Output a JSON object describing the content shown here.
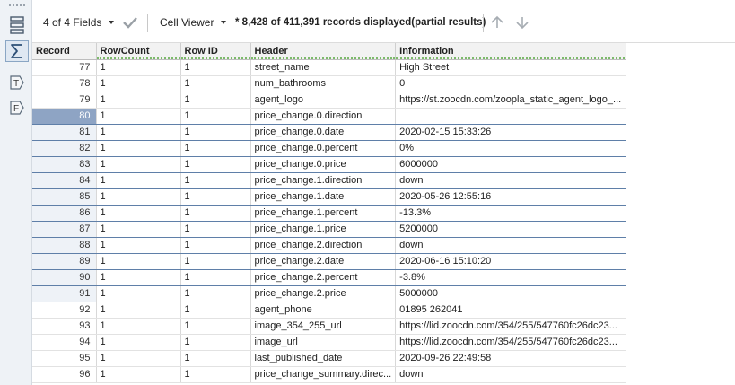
{
  "toolbar": {
    "fields_label": "4 of 4 Fields",
    "viewer_label": "Cell Viewer",
    "status_text": "* 8,428 of 411,391 records displayed(partial results)"
  },
  "rail": {
    "icons": [
      "table-view-icon",
      "summarize-icon",
      "text-type-icon",
      "formula-type-icon"
    ]
  },
  "grid": {
    "columns": [
      "Record",
      "RowCount",
      "Row ID",
      "Header",
      "Information"
    ],
    "active_record": "80",
    "rows": [
      {
        "record": "77",
        "rowcount": "1",
        "rowid": "1",
        "header": "street_name",
        "info": "High Street",
        "selected": false
      },
      {
        "record": "78",
        "rowcount": "1",
        "rowid": "1",
        "header": "num_bathrooms",
        "info": "0",
        "selected": false
      },
      {
        "record": "79",
        "rowcount": "1",
        "rowid": "1",
        "header": "agent_logo",
        "info": "https://st.zoocdn.com/zoopla_static_agent_logo_...",
        "selected": false
      },
      {
        "record": "80",
        "rowcount": "1",
        "rowid": "1",
        "header": "price_change.0.direction",
        "info": "",
        "selected": true
      },
      {
        "record": "81",
        "rowcount": "1",
        "rowid": "1",
        "header": "price_change.0.date",
        "info": "2020-02-15 15:33:26",
        "selected": true
      },
      {
        "record": "82",
        "rowcount": "1",
        "rowid": "1",
        "header": "price_change.0.percent",
        "info": "0%",
        "selected": true
      },
      {
        "record": "83",
        "rowcount": "1",
        "rowid": "1",
        "header": "price_change.0.price",
        "info": "6000000",
        "selected": true
      },
      {
        "record": "84",
        "rowcount": "1",
        "rowid": "1",
        "header": "price_change.1.direction",
        "info": "down",
        "selected": true
      },
      {
        "record": "85",
        "rowcount": "1",
        "rowid": "1",
        "header": "price_change.1.date",
        "info": "2020-05-26 12:55:16",
        "selected": true
      },
      {
        "record": "86",
        "rowcount": "1",
        "rowid": "1",
        "header": "price_change.1.percent",
        "info": "-13.3%",
        "selected": true
      },
      {
        "record": "87",
        "rowcount": "1",
        "rowid": "1",
        "header": "price_change.1.price",
        "info": "5200000",
        "selected": true
      },
      {
        "record": "88",
        "rowcount": "1",
        "rowid": "1",
        "header": "price_change.2.direction",
        "info": "down",
        "selected": true
      },
      {
        "record": "89",
        "rowcount": "1",
        "rowid": "1",
        "header": "price_change.2.date",
        "info": "2020-06-16 15:10:20",
        "selected": true
      },
      {
        "record": "90",
        "rowcount": "1",
        "rowid": "1",
        "header": "price_change.2.percent",
        "info": "-3.8%",
        "selected": true
      },
      {
        "record": "91",
        "rowcount": "1",
        "rowid": "1",
        "header": "price_change.2.price",
        "info": "5000000",
        "selected": true
      },
      {
        "record": "92",
        "rowcount": "1",
        "rowid": "1",
        "header": "agent_phone",
        "info": "01895 262041",
        "selected": false
      },
      {
        "record": "93",
        "rowcount": "1",
        "rowid": "1",
        "header": "image_354_255_url",
        "info": "https://lid.zoocdn.com/354/255/547760fc26dc23...",
        "selected": false
      },
      {
        "record": "94",
        "rowcount": "1",
        "rowid": "1",
        "header": "image_url",
        "info": "https://lid.zoocdn.com/354/255/547760fc26dc23...",
        "selected": false
      },
      {
        "record": "95",
        "rowcount": "1",
        "rowid": "1",
        "header": "last_published_date",
        "info": "2020-09-26 22:49:58",
        "selected": false
      },
      {
        "record": "96",
        "rowcount": "1",
        "rowid": "1",
        "header": "price_change_summary.direc...",
        "info": "down",
        "selected": false
      }
    ]
  },
  "colors": {
    "selection_border": "#5f7fa8",
    "active_record_bg": "#8ea4c4",
    "header_underline": "#7cba6a"
  }
}
